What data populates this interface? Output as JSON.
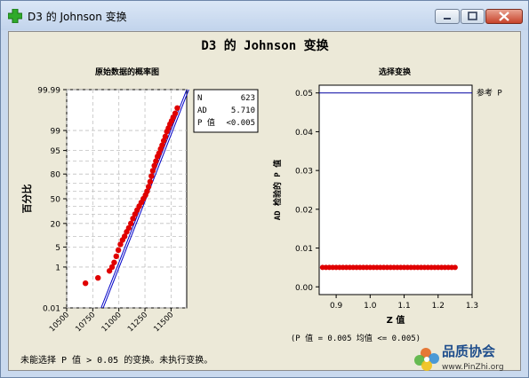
{
  "window": {
    "title": "D3 的 Johnson 变换",
    "accent": "#c2d4ec",
    "close_color": "#c7432b"
  },
  "icons": [
    "green-plus-icon",
    "minimize-icon",
    "maximize-icon",
    "close-icon"
  ],
  "graph": {
    "main_title": "D3 的 Johnson 变换",
    "footer_note": "未能选择 P 值 > 0.05 的变换。未执行变换。"
  },
  "stats": {
    "n_label": "N",
    "n_value": "623",
    "ad_label": "AD",
    "ad_value": "5.710",
    "p_label": "P 值",
    "p_value": "<0.005"
  },
  "watermark": {
    "name": "品质协会",
    "url": "www.PinZhi.org"
  },
  "chart_data": [
    {
      "type": "scatter",
      "title": "原始数据的概率图",
      "ylabel": "百分比",
      "xlabel": "",
      "x_ticks": [
        "10500",
        "10750",
        "11000",
        "11250",
        "11500"
      ],
      "y_ticks": [
        "0.01",
        "1",
        "5",
        "20",
        "50",
        "80",
        "95",
        "99",
        "99.99"
      ],
      "xlim": [
        10500,
        11650
      ],
      "y_scale": "normal-probability",
      "grid": true,
      "points": [
        [
          10680,
          0.2
        ],
        [
          10800,
          0.35
        ],
        [
          10910,
          0.7
        ],
        [
          10935,
          1.0
        ],
        [
          10955,
          1.5
        ],
        [
          10975,
          2.5
        ],
        [
          10995,
          4
        ],
        [
          11015,
          6
        ],
        [
          11035,
          8
        ],
        [
          11055,
          10
        ],
        [
          11075,
          13
        ],
        [
          11095,
          16
        ],
        [
          11115,
          20
        ],
        [
          11135,
          25
        ],
        [
          11155,
          30
        ],
        [
          11175,
          35
        ],
        [
          11195,
          40
        ],
        [
          11215,
          45
        ],
        [
          11235,
          50
        ],
        [
          11255,
          55
        ],
        [
          11270,
          60
        ],
        [
          11285,
          66
        ],
        [
          11300,
          72
        ],
        [
          11312,
          78
        ],
        [
          11325,
          83
        ],
        [
          11340,
          87
        ],
        [
          11355,
          90
        ],
        [
          11370,
          92.5
        ],
        [
          11385,
          94
        ],
        [
          11400,
          95.5
        ],
        [
          11415,
          96.6
        ],
        [
          11430,
          97.6
        ],
        [
          11445,
          98.3
        ],
        [
          11460,
          98.9
        ],
        [
          11475,
          99.2
        ],
        [
          11490,
          99.45
        ],
        [
          11505,
          99.6
        ],
        [
          11520,
          99.72
        ],
        [
          11540,
          99.82
        ],
        [
          11560,
          99.9
        ]
      ],
      "fit_lines": [
        {
          "name": "fit-1",
          "x": [
            10830,
            11650
          ],
          "y": [
            0.01,
            99.99
          ]
        },
        {
          "name": "fit-2",
          "x": [
            10850,
            11670
          ],
          "y": [
            0.01,
            99.99
          ]
        }
      ],
      "colors": {
        "points": "#e00000",
        "fit": "#0000c8",
        "grid": "#c0c0c0"
      }
    },
    {
      "type": "scatter",
      "title": "选择变换",
      "xlabel": "Z 值",
      "ylabel": "AD 检验的 P 值",
      "x_ticks": [
        "0.9",
        "1.0",
        "1.1",
        "1.2",
        "1.3"
      ],
      "y_ticks": [
        "0.00",
        "0.01",
        "0.02",
        "0.03",
        "0.04",
        "0.05"
      ],
      "xlim": [
        0.85,
        1.3
      ],
      "ylim": [
        -0.002,
        0.052
      ],
      "reference_line": {
        "value": 0.05,
        "label": "参考 P"
      },
      "annotation": "(P 值 = 0.005 均值 <= 0.005)",
      "z_values": [
        0.86,
        0.87,
        0.88,
        0.89,
        0.9,
        0.91,
        0.92,
        0.93,
        0.94,
        0.95,
        0.96,
        0.97,
        0.98,
        0.99,
        1.0,
        1.01,
        1.02,
        1.03,
        1.04,
        1.05,
        1.06,
        1.07,
        1.08,
        1.09,
        1.1,
        1.11,
        1.12,
        1.13,
        1.14,
        1.15,
        1.16,
        1.17,
        1.18,
        1.19,
        1.2,
        1.21,
        1.22,
        1.23,
        1.24,
        1.25
      ],
      "p_values": 0.005,
      "colors": {
        "points": "#e00000",
        "reference": "#0000a0"
      }
    }
  ]
}
